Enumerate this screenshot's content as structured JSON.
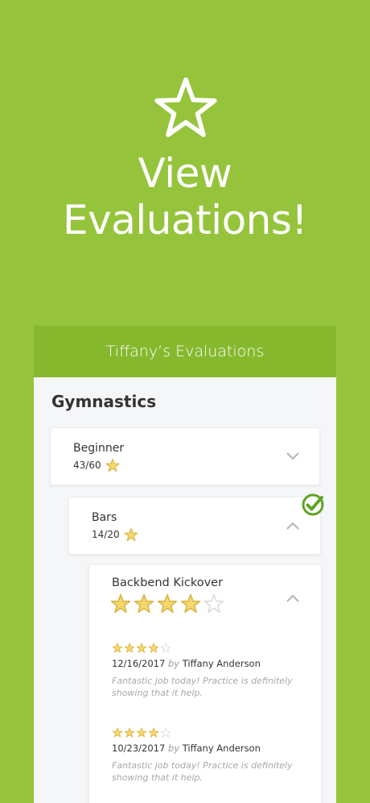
{
  "hero": {
    "title_line1": "View",
    "title_line2": "Evaluations!",
    "icon": "star-outline-icon"
  },
  "app": {
    "header_title": "Tiffany’s Evaluations",
    "section_title": "Gymnastics",
    "level": {
      "name": "Beginner",
      "score": "43/60",
      "expanded": false
    },
    "event": {
      "name": "Bars",
      "score": "14/20",
      "expanded": true,
      "completed": true
    },
    "skill": {
      "name": "Backbend Kickover",
      "rating": 4,
      "max_rating": 5,
      "expanded": true,
      "evaluations": [
        {
          "rating": 4,
          "max_rating": 5,
          "date": "12/16/2017",
          "by_label": "by",
          "evaluator": "Tiffany Anderson",
          "comment": "Fantastic job today!  Practice is definitely showing that it help."
        },
        {
          "rating": 4,
          "max_rating": 5,
          "date": "10/23/2017",
          "by_label": "by",
          "evaluator": "Tiffany Anderson",
          "comment": "Fantastic job today!  Practice is definitely showing that it help."
        }
      ]
    }
  },
  "colors": {
    "background": "#95c43c",
    "header": "#86b82e",
    "star_fill": "#f5d76e",
    "star_stroke": "#d8b441",
    "check": "#5fa324"
  }
}
